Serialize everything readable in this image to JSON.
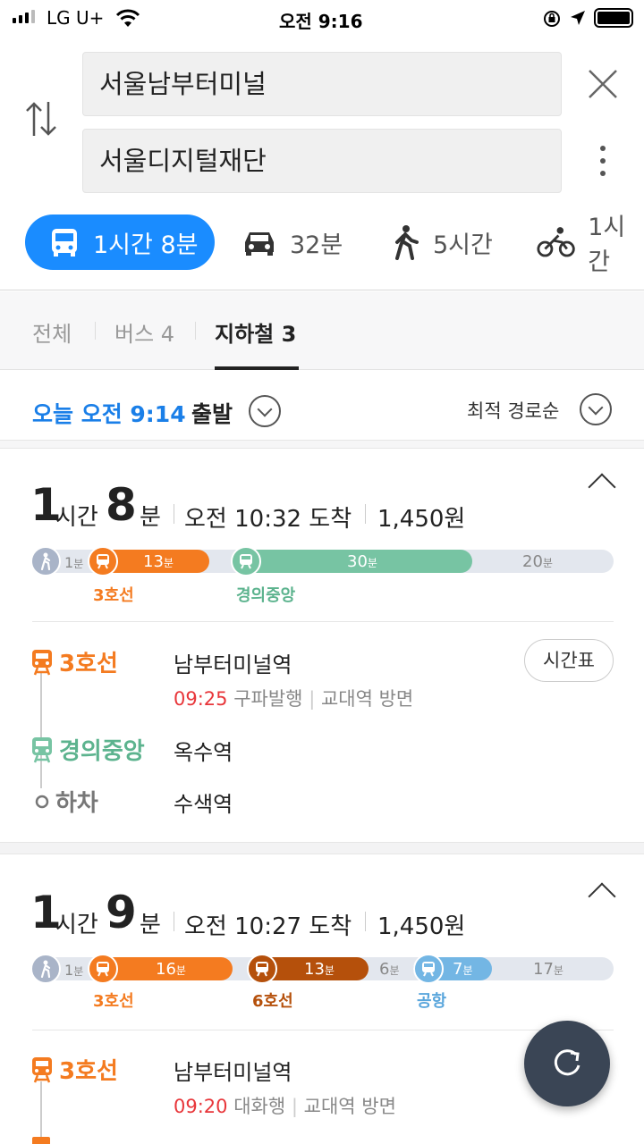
{
  "status": {
    "carrier": "LG U+",
    "time": "오전 9:16"
  },
  "search": {
    "origin": "서울남부터미널",
    "destination": "서울디지털재단"
  },
  "modes": [
    {
      "label": "1시간 8분",
      "icon": "bus-icon",
      "active": true
    },
    {
      "label": "32분",
      "icon": "car-icon"
    },
    {
      "label": "5시간",
      "icon": "walk-icon"
    },
    {
      "label": "1시간",
      "icon": "bike-icon"
    }
  ],
  "tabs": [
    {
      "label": "전체"
    },
    {
      "label": "버스 4"
    },
    {
      "label": "지하철 3",
      "active": true
    }
  ],
  "depart": {
    "label": "오늘 오전 9:14",
    "suffix": "출발",
    "sort": "최적 경로순"
  },
  "colors": {
    "blue": "#1a8cff",
    "line3": "#f47b20",
    "gyeongui": "#77c4a3",
    "line6": "#b5500b",
    "airport": "#73b6e4",
    "walk": "#a9b4c8"
  },
  "routes": [
    {
      "hours": "1",
      "hours_unit": "시간",
      "mins": "8",
      "mins_unit": "분",
      "arrival": "오전 10:32 도착",
      "fare": "1,450원",
      "segments": [
        {
          "mode": "walk",
          "min": "1",
          "unit": "분"
        },
        {
          "mode": "subway",
          "line": "3호선",
          "min": "13",
          "unit": "분"
        },
        {
          "mode": "subway",
          "line": "경의중앙",
          "min": "30",
          "unit": "분"
        },
        {
          "mode": "walk",
          "min": "20",
          "unit": "분"
        }
      ],
      "steps": [
        {
          "line": "3호선",
          "station": "남부터미널역",
          "time": "09:25",
          "dest": "구파발행",
          "dir": "교대역 방면",
          "button": "시간표"
        },
        {
          "line": "경의중앙",
          "station": "옥수역"
        },
        {
          "line": "하차",
          "station": "수색역"
        }
      ]
    },
    {
      "hours": "1",
      "hours_unit": "시간",
      "mins": "9",
      "mins_unit": "분",
      "arrival": "오전 10:27 도착",
      "fare": "1,450원",
      "segments": [
        {
          "mode": "walk",
          "min": "1",
          "unit": "분"
        },
        {
          "mode": "subway",
          "line": "3호선",
          "min": "16",
          "unit": "분"
        },
        {
          "mode": "subway",
          "line": "6호선",
          "min": "13",
          "unit": "분"
        },
        {
          "mode": "walk",
          "min": "6",
          "unit": "분"
        },
        {
          "mode": "subway",
          "line": "공항",
          "min": "7",
          "unit": "분"
        },
        {
          "mode": "walk",
          "min": "17",
          "unit": "분"
        }
      ],
      "steps": [
        {
          "line": "3호선",
          "station": "남부터미널역",
          "time": "09:20",
          "dest": "대화행",
          "dir": "교대역 방면"
        }
      ]
    }
  ]
}
